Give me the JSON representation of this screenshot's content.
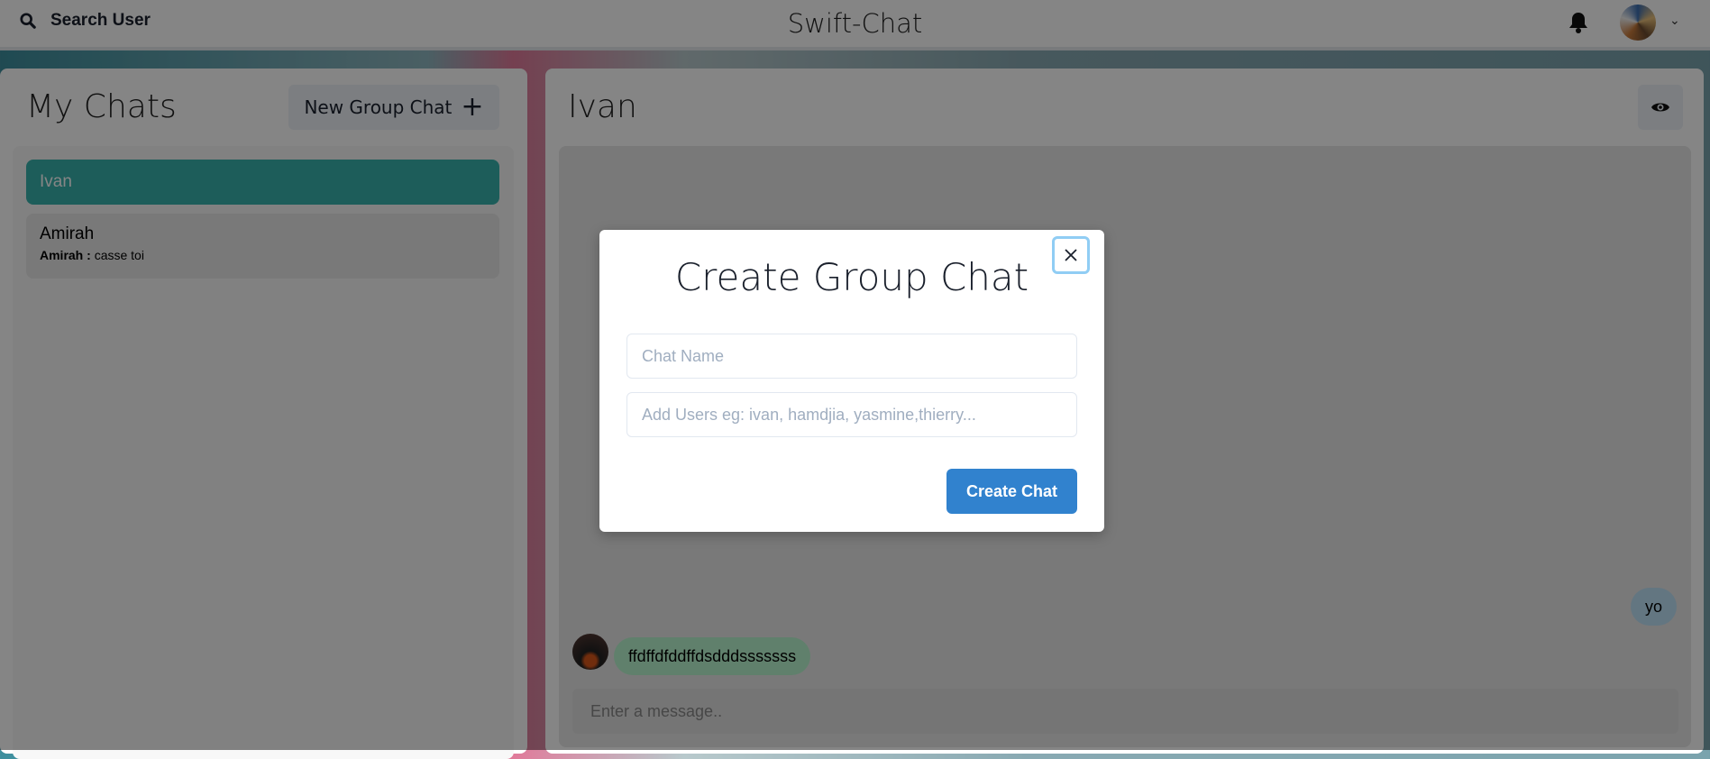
{
  "header": {
    "search_label": "Search User",
    "app_title": "Swift-Chat",
    "icons": [
      "search-icon",
      "bell-icon",
      "avatar",
      "chevron-down-icon"
    ]
  },
  "sidebar": {
    "title": "My Chats",
    "new_group_label": "New Group Chat",
    "chats": [
      {
        "name": "Ivan",
        "selected": true
      },
      {
        "name": "Amirah",
        "latest_sender": "Amirah :",
        "latest_message": "casse toi"
      }
    ]
  },
  "chat": {
    "title": "Ivan",
    "messages": [
      {
        "text": "yo",
        "own": true
      },
      {
        "text": "ffdffdfddffdsdddsssssss",
        "own": false
      }
    ],
    "input_placeholder": "Enter a message.."
  },
  "modal": {
    "title": "Create Group Chat",
    "chat_name_placeholder": "Chat Name",
    "users_placeholder": "Add Users eg: ivan, hamdjia, yasmine,thierry...",
    "submit_label": "Create Chat"
  },
  "colors": {
    "accent": "#38B2AC",
    "primary": "#3182CE",
    "own_bubble": "#BEE3F8",
    "other_bubble": "#B9F5D0"
  }
}
